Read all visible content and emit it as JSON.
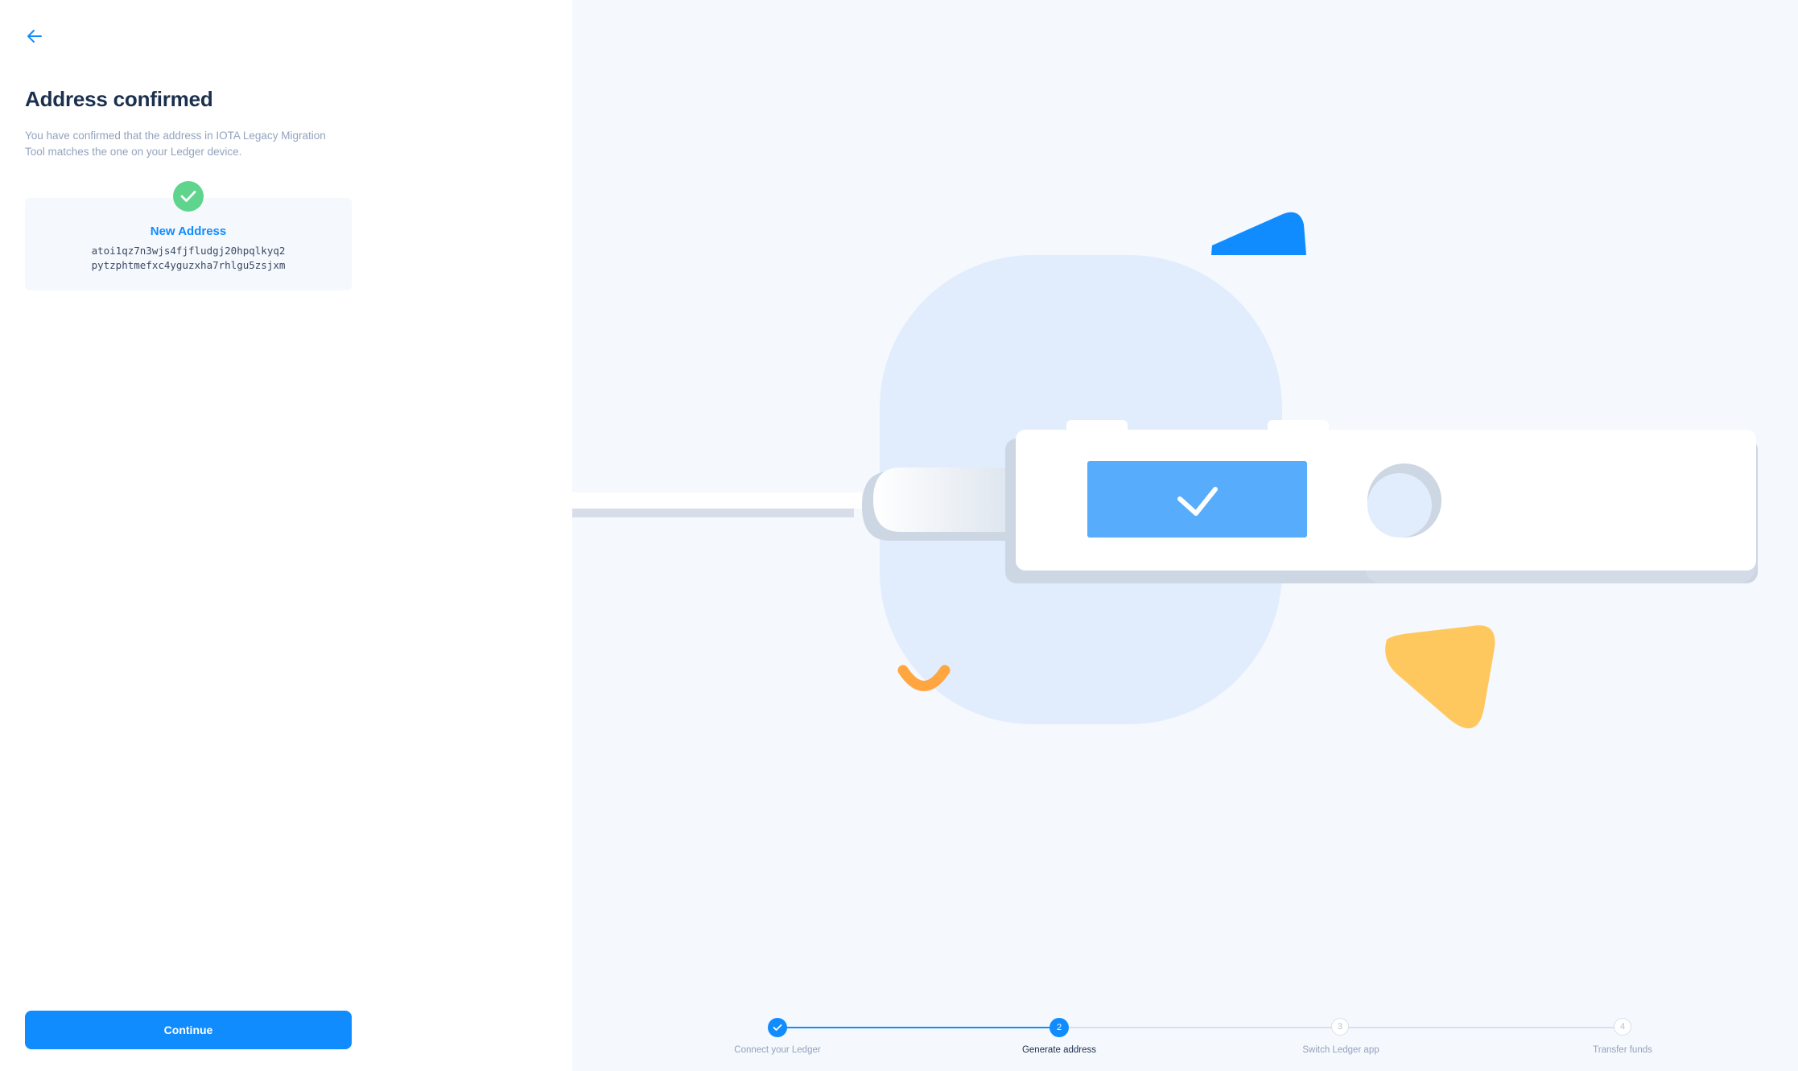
{
  "header": {
    "back_icon": "arrow-left-icon"
  },
  "main": {
    "title": "Address confirmed",
    "description": "You have confirmed that the address in IOTA Legacy Migration Tool matches the one on your Ledger device.",
    "address_card": {
      "status_icon": "check-circle-icon",
      "label": "New Address",
      "address_line1": "atoi1qz7n3wjs4fjfludgj20hpqlkyq2",
      "address_line2": "pytzphtmefxc4yguzxha7rhlgu5zsjxm"
    },
    "continue_label": "Continue"
  },
  "stepper": {
    "steps": [
      {
        "label": "Connect your Ledger",
        "number": "1",
        "state": "complete"
      },
      {
        "label": "Generate address",
        "number": "2",
        "state": "active"
      },
      {
        "label": "Switch Ledger app",
        "number": "3",
        "state": "pending"
      },
      {
        "label": "Transfer funds",
        "number": "4",
        "state": "pending"
      }
    ]
  },
  "colors": {
    "accent": "#108cff",
    "success": "#5ed48c",
    "title": "#1b2f4e",
    "muted": "#93a3bd",
    "panel_bg": "#f5f8fd",
    "device_screen": "#57acfb",
    "shape_yellow": "#ffc85f",
    "shape_orange": "#ffa640"
  }
}
